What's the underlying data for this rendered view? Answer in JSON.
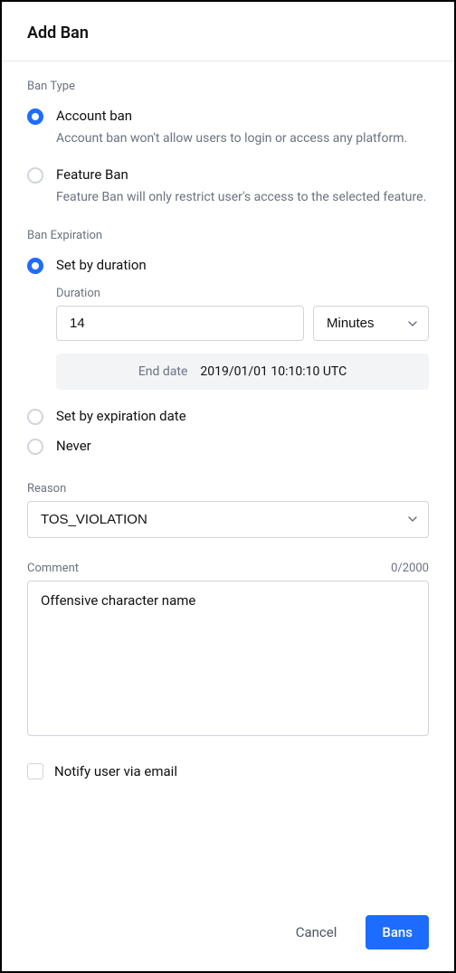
{
  "header": {
    "title": "Add Ban"
  },
  "banType": {
    "sectionLabel": "Ban Type",
    "options": [
      {
        "label": "Account ban",
        "desc": "Account ban won't allow users to login or access any platform."
      },
      {
        "label": "Feature Ban",
        "desc": "Feature Ban will only restrict user's access to the selected feature."
      }
    ]
  },
  "expiration": {
    "sectionLabel": "Ban Expiration",
    "options": {
      "byDuration": "Set by duration",
      "byDate": "Set by expiration date",
      "never": "Never"
    },
    "durationLabel": "Duration",
    "durationValue": "14",
    "unitValue": "Minutes",
    "endDateLabel": "End date",
    "endDateValue": "2019/01/01 10:10:10 UTC"
  },
  "reason": {
    "label": "Reason",
    "value": "TOS_VIOLATION"
  },
  "comment": {
    "label": "Comment",
    "counter": "0/2000",
    "value": "Offensive character name"
  },
  "notify": {
    "label": "Notify user via email"
  },
  "footer": {
    "cancel": "Cancel",
    "submit": "Bans"
  }
}
